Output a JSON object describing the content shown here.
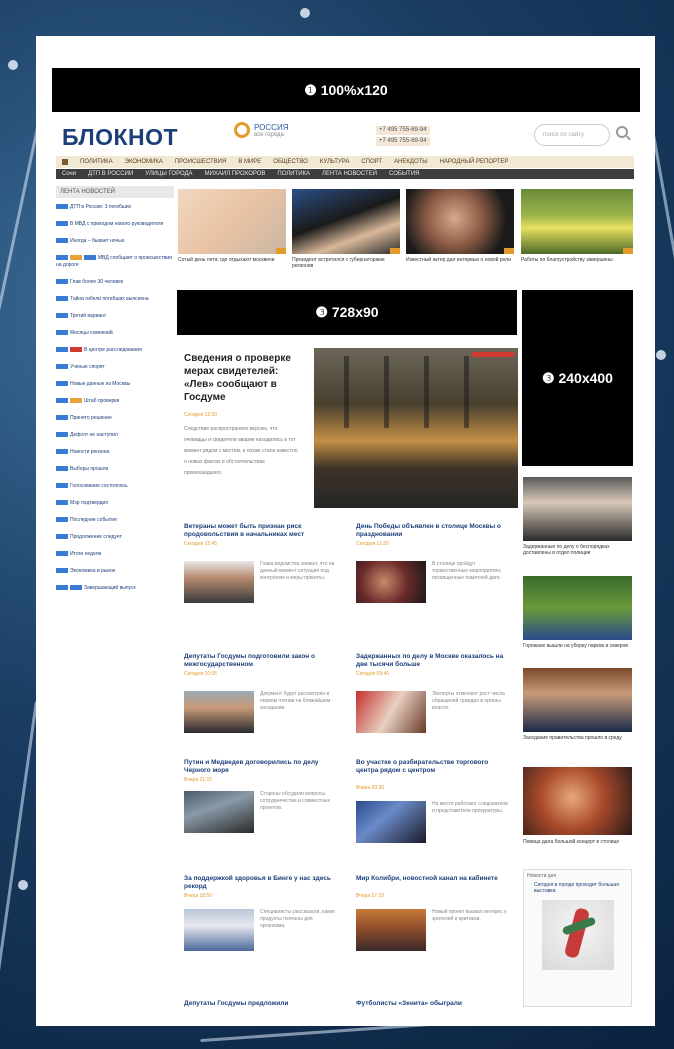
{
  "ads": {
    "top": "❶ 100%x120",
    "mid": "❸ 728x90",
    "side": "❸ 240x400"
  },
  "header": {
    "logo": "БЛОКНОТ",
    "region_title": "РОССИЯ",
    "region_sub": "все города",
    "phone1": "+7 495 755-69-94",
    "phone2": "+7 495 755-69-94",
    "search_placeholder": "поиск по сайту"
  },
  "nav_main": [
    "ПОЛИТИКА",
    "ЭКОНОМИКА",
    "ПРОИСШЕСТВИЯ",
    "В МИРЕ",
    "ОБЩЕСТВО",
    "КУЛЬТУРА",
    "СПОРТ",
    "АНЕКДОТЫ",
    "НАРОДНЫЙ РЕПОРТЕР"
  ],
  "nav_sub": [
    "Сочи",
    "ДТП В РОССИИ",
    "УЛИЦЫ ГОРОДА",
    "МИХАИЛ ПРОХОРОВ",
    "ПОЛИТИКА",
    "ЛЕНТА НОВОСТЕЙ",
    "СОБЫТИЯ"
  ],
  "sidebar": {
    "header": "ЛЕНТА НОВОСТЕЙ",
    "items": [
      "ДТП в России: 3 погибших",
      "В МВД с приходом нового руководителя",
      "Иногда – бывает ночью",
      "МВД сообщает о происшествии на дороге",
      "Глав более 30 человек",
      "Тайна гибели погибших выяснена",
      "Третий вариант",
      "Месяцы сомнений",
      "В центре расследования",
      "Ученые спорят",
      "Новые данные из Москвы",
      "Штаб проверки",
      "Принято решение",
      "Дефолт не наступил",
      "Новости региона",
      "Выборы прошли",
      "Голосование состоялось",
      "Мэр подтвердил",
      "Последние события",
      "Продолжение следует",
      "Итоги недели",
      "Экономика и рынок",
      "Завершающий выпуск"
    ]
  },
  "top_row": [
    "Сотый день лета: где отдыхают москвичи",
    "Президент встретился с губернаторами регионов",
    "Известный актер дал интервью о новой роли",
    "Работы по благоустройству завершены"
  ],
  "featured": {
    "title": "Сведения о проверке мерах свидетелей: «Лев» сообщают в Госдуме",
    "date": "Сегодня 12:30",
    "lead": "Следствие распространяло версию, что очевидцы и свидетели аварии находились в тот момент рядом с местом, а позже стало известно о новых фактах и обстоятельствах произошедшего."
  },
  "news": [
    {
      "title": "Ветераны может быть признан риск продовольствия в начальниках мест",
      "meta": "Сегодня 12:45",
      "text": "Глава ведомства заявил, что на данный момент ситуация под контролем и меры приняты."
    },
    {
      "title": "День Победы объявлен в столице Москвы о праздновании",
      "meta": "Сегодня 11:20",
      "text": "В столице пройдут торжественные мероприятия, посвященные памятной дате."
    },
    {
      "title": "Депутаты Госдумы подготовили закон о межгосударственном",
      "meta": "Сегодня 10:05",
      "text": "Документ будет рассмотрен в первом чтении на ближайшем заседании."
    },
    {
      "title": "Задержанных по делу в Москве оказалось на две тысячи больше",
      "meta": "Сегодня 09:40",
      "text": "Эксперты отмечают рост числа обращений граждан в органы власти."
    },
    {
      "title": "Путин и Медведев договорились по делу Черного моря",
      "meta": "Вчера 21:15",
      "text": "Стороны обсудили вопросы сотрудничества и совместных проектов."
    },
    {
      "title": "Во участке о разбирательстве торгового центра рядом с центром",
      "meta": "Вчера 20:30",
      "text": "На месте работают следователи и представители прокуратуры."
    },
    {
      "title": "За поддержкой здоровья в Бинге у нас здесь рекорд",
      "meta": "Вчера 18:50",
      "text": "Специалисты рассказали, какие продукты полезны для организма."
    },
    {
      "title": "Мир Колибри, новостной канал на кабинете",
      "meta": "Вчера 17:10",
      "text": "Новый проект вызвал интерес у зрителей и критиков."
    },
    {
      "title": "Депутаты Госдумы предложили",
      "meta": "",
      "text": ""
    },
    {
      "title": "Футболисты «Зенита» обыграли",
      "meta": "",
      "text": ""
    }
  ],
  "side_photos": [
    "Задержанные по делу о беспорядках доставлены в отдел полиции",
    "Горожане вышли на уборку парков и скверов",
    "Заседание правительства прошло в среду",
    "Певица дала большой концерт в столице"
  ],
  "widget": {
    "header": "Новости дня",
    "link": "Сегодня в городе проходит большая выставка"
  },
  "colors": {
    "brand": "#1c3f7a",
    "accent": "#e39a2a",
    "nav_dark": "#3d3d3d"
  }
}
